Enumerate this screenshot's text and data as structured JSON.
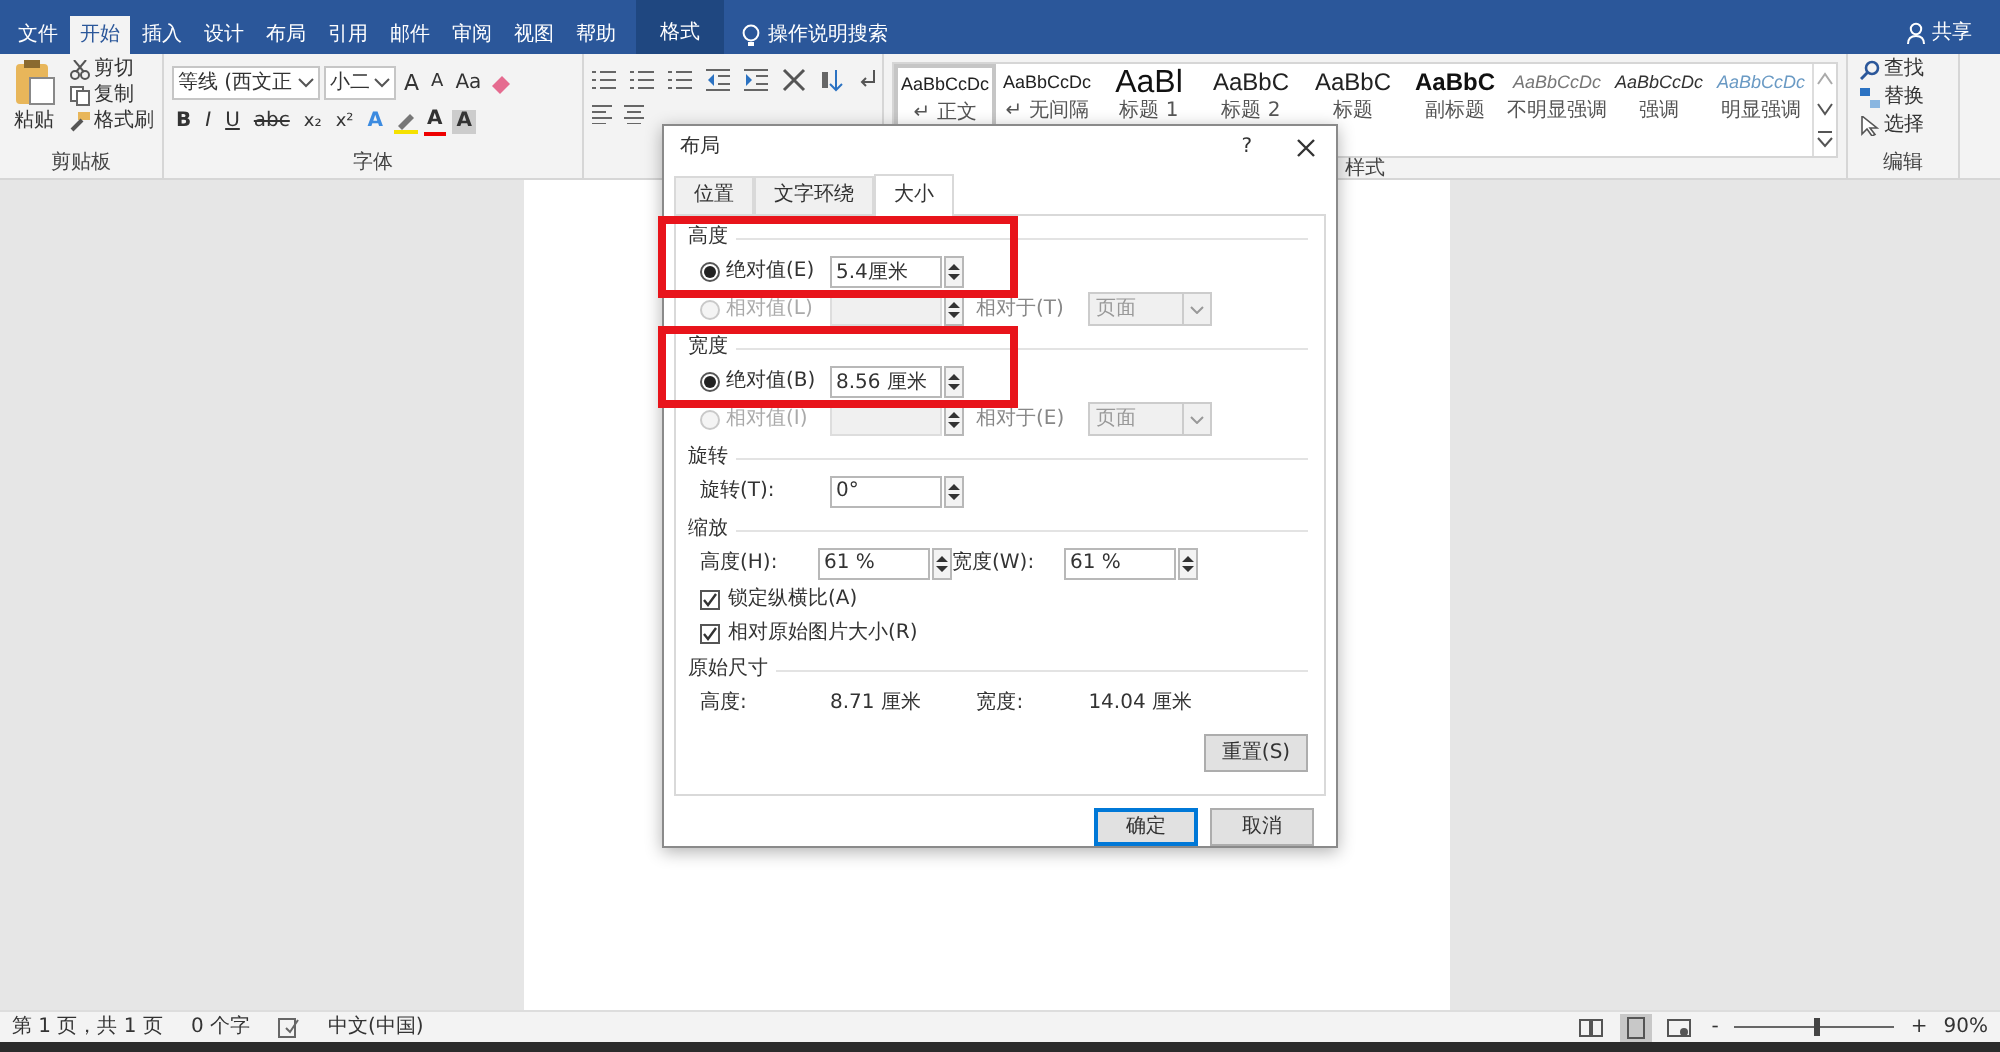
{
  "title_bar": {
    "tabs": [
      {
        "label": "文件",
        "selected": false,
        "kind": "normal"
      },
      {
        "label": "开始",
        "selected": true,
        "kind": "normal"
      },
      {
        "label": "插入",
        "selected": false,
        "kind": "normal"
      },
      {
        "label": "设计",
        "selected": false,
        "kind": "normal"
      },
      {
        "label": "布局",
        "selected": false,
        "kind": "normal"
      },
      {
        "label": "引用",
        "selected": false,
        "kind": "normal"
      },
      {
        "label": "邮件",
        "selected": false,
        "kind": "normal"
      },
      {
        "label": "审阅",
        "selected": false,
        "kind": "normal"
      },
      {
        "label": "视图",
        "selected": false,
        "kind": "normal"
      },
      {
        "label": "帮助",
        "selected": false,
        "kind": "normal"
      },
      {
        "label": "格式",
        "selected": false,
        "kind": "contextual"
      }
    ],
    "tell_me": "操作说明搜索",
    "share": "共享"
  },
  "ribbon": {
    "clipboard": {
      "paste": "粘贴",
      "cut": "剪切",
      "copy": "复制",
      "format_painter": "格式刷",
      "label": "剪贴板"
    },
    "font": {
      "font_name": "等线 (西文正",
      "font_size": "小二",
      "grow": "A",
      "shrink": "A",
      "case": "Aa",
      "format_buttons": [
        "B",
        "I",
        "U",
        "abc",
        "x₂",
        "x²"
      ],
      "effects": "A",
      "font_color": "A",
      "shading": "A",
      "label": "字体"
    },
    "styles": {
      "items": [
        {
          "preview": "AaBbCcDc",
          "name": "↵ 正文",
          "kind": "body",
          "selected": true
        },
        {
          "preview": "AaBbCcDc",
          "name": "↵ 无间隔",
          "kind": "body",
          "selected": false
        },
        {
          "preview": "AaBl",
          "name": "标题 1",
          "kind": "heading1",
          "selected": false
        },
        {
          "preview": "AaBbC",
          "name": "标题 2",
          "kind": "heading2",
          "selected": false
        },
        {
          "preview": "AaBbC",
          "name": "标题",
          "kind": "heading2",
          "selected": false
        },
        {
          "preview": "AaBbC",
          "name": "副标题",
          "kind": "strong",
          "selected": false
        },
        {
          "preview": "AaBbCcDc",
          "name": "不明显强调",
          "kind": "subtle",
          "selected": false
        },
        {
          "preview": "AaBbCcDc",
          "name": "强调",
          "kind": "emphasis",
          "selected": false
        },
        {
          "preview": "AaBbCcDc",
          "name": "明显强调",
          "kind": "intense",
          "selected": false
        }
      ],
      "label": "样式"
    },
    "editing": {
      "find": "查找",
      "replace": "替换",
      "select": "选择",
      "label": "编辑"
    }
  },
  "dialog": {
    "title": "布局",
    "help": "?",
    "tabs": [
      {
        "label": "位置",
        "selected": false
      },
      {
        "label": "文字环绕",
        "selected": false
      },
      {
        "label": "大小",
        "selected": true
      }
    ],
    "height": {
      "title": "高度",
      "highlighted": true,
      "absolute": {
        "label": "绝对值(E)",
        "selected": true,
        "value": "5.4厘米"
      },
      "relative": {
        "label": "相对值(L)",
        "selected": false,
        "disabled": true
      },
      "relative_to": {
        "label": "相对于(T)",
        "value": "页面",
        "disabled": true
      }
    },
    "width": {
      "title": "宽度",
      "highlighted": true,
      "absolute": {
        "label": "绝对值(B)",
        "selected": true,
        "value": "8.56 厘米"
      },
      "relative": {
        "label": "相对值(I)",
        "selected": false,
        "disabled": true
      },
      "relative_to": {
        "label": "相对于(E)",
        "value": "页面",
        "disabled": true
      }
    },
    "rotation": {
      "title": "旋转",
      "label": "旋转(T):",
      "value": "0°"
    },
    "scale": {
      "title": "缩放",
      "height_label": "高度(H):",
      "height_value": "61 %",
      "width_label": "宽度(W):",
      "width_value": "61 %",
      "checks": [
        {
          "label": "锁定纵横比(A)",
          "checked": true
        },
        {
          "label": "相对原始图片大小(R)",
          "checked": true
        }
      ]
    },
    "original_size": {
      "title": "原始尺寸",
      "height_label": "高度:",
      "height_value": "8.71 厘米",
      "width_label": "宽度:",
      "width_value": "14.04 厘米"
    },
    "reset": "重置(S)",
    "ok": "确定",
    "cancel": "取消"
  },
  "status_bar": {
    "page": "第 1 页，共 1 页",
    "words": "0 个字",
    "language": "中文(中国)",
    "views": [
      {
        "kind": "read",
        "selected": false
      },
      {
        "kind": "print",
        "selected": true
      },
      {
        "kind": "web",
        "selected": false
      }
    ],
    "zoom_out": "-",
    "zoom_in": "+",
    "zoom": {
      "level": 0.5,
      "reading": "90%"
    }
  }
}
